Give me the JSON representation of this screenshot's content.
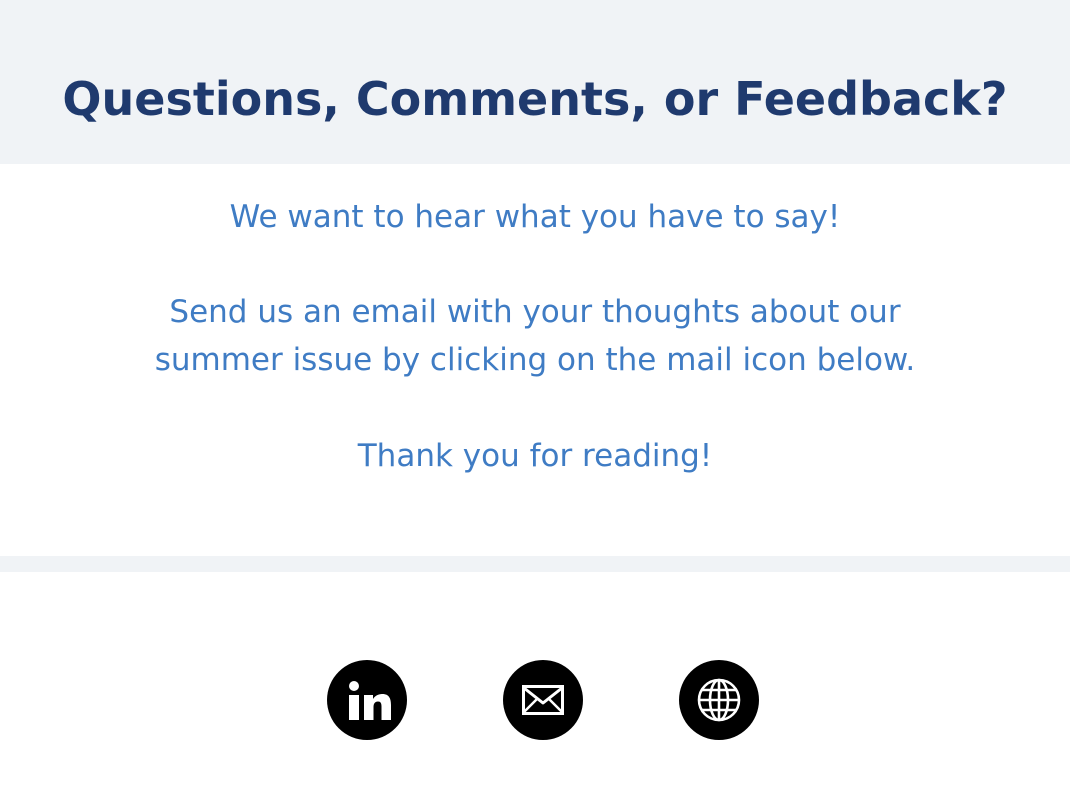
{
  "header": {
    "title": "Questions, Comments, or Feedback?"
  },
  "message": {
    "line1": "We want to hear what you have to say!",
    "line2a": "Send us an email with your thoughts about our",
    "line2b": "summer issue by clicking on the mail icon below.",
    "line3": "Thank you for reading!"
  },
  "social": {
    "items": [
      {
        "icon": "linkedin-icon"
      },
      {
        "icon": "mail-icon"
      },
      {
        "icon": "globe-icon"
      }
    ]
  },
  "colors": {
    "title": "#1f3a6e",
    "body_text": "#3f7cc4",
    "band": "#f0f3f6",
    "icon_circle": "#000000",
    "icon_glyph": "#ffffff"
  }
}
